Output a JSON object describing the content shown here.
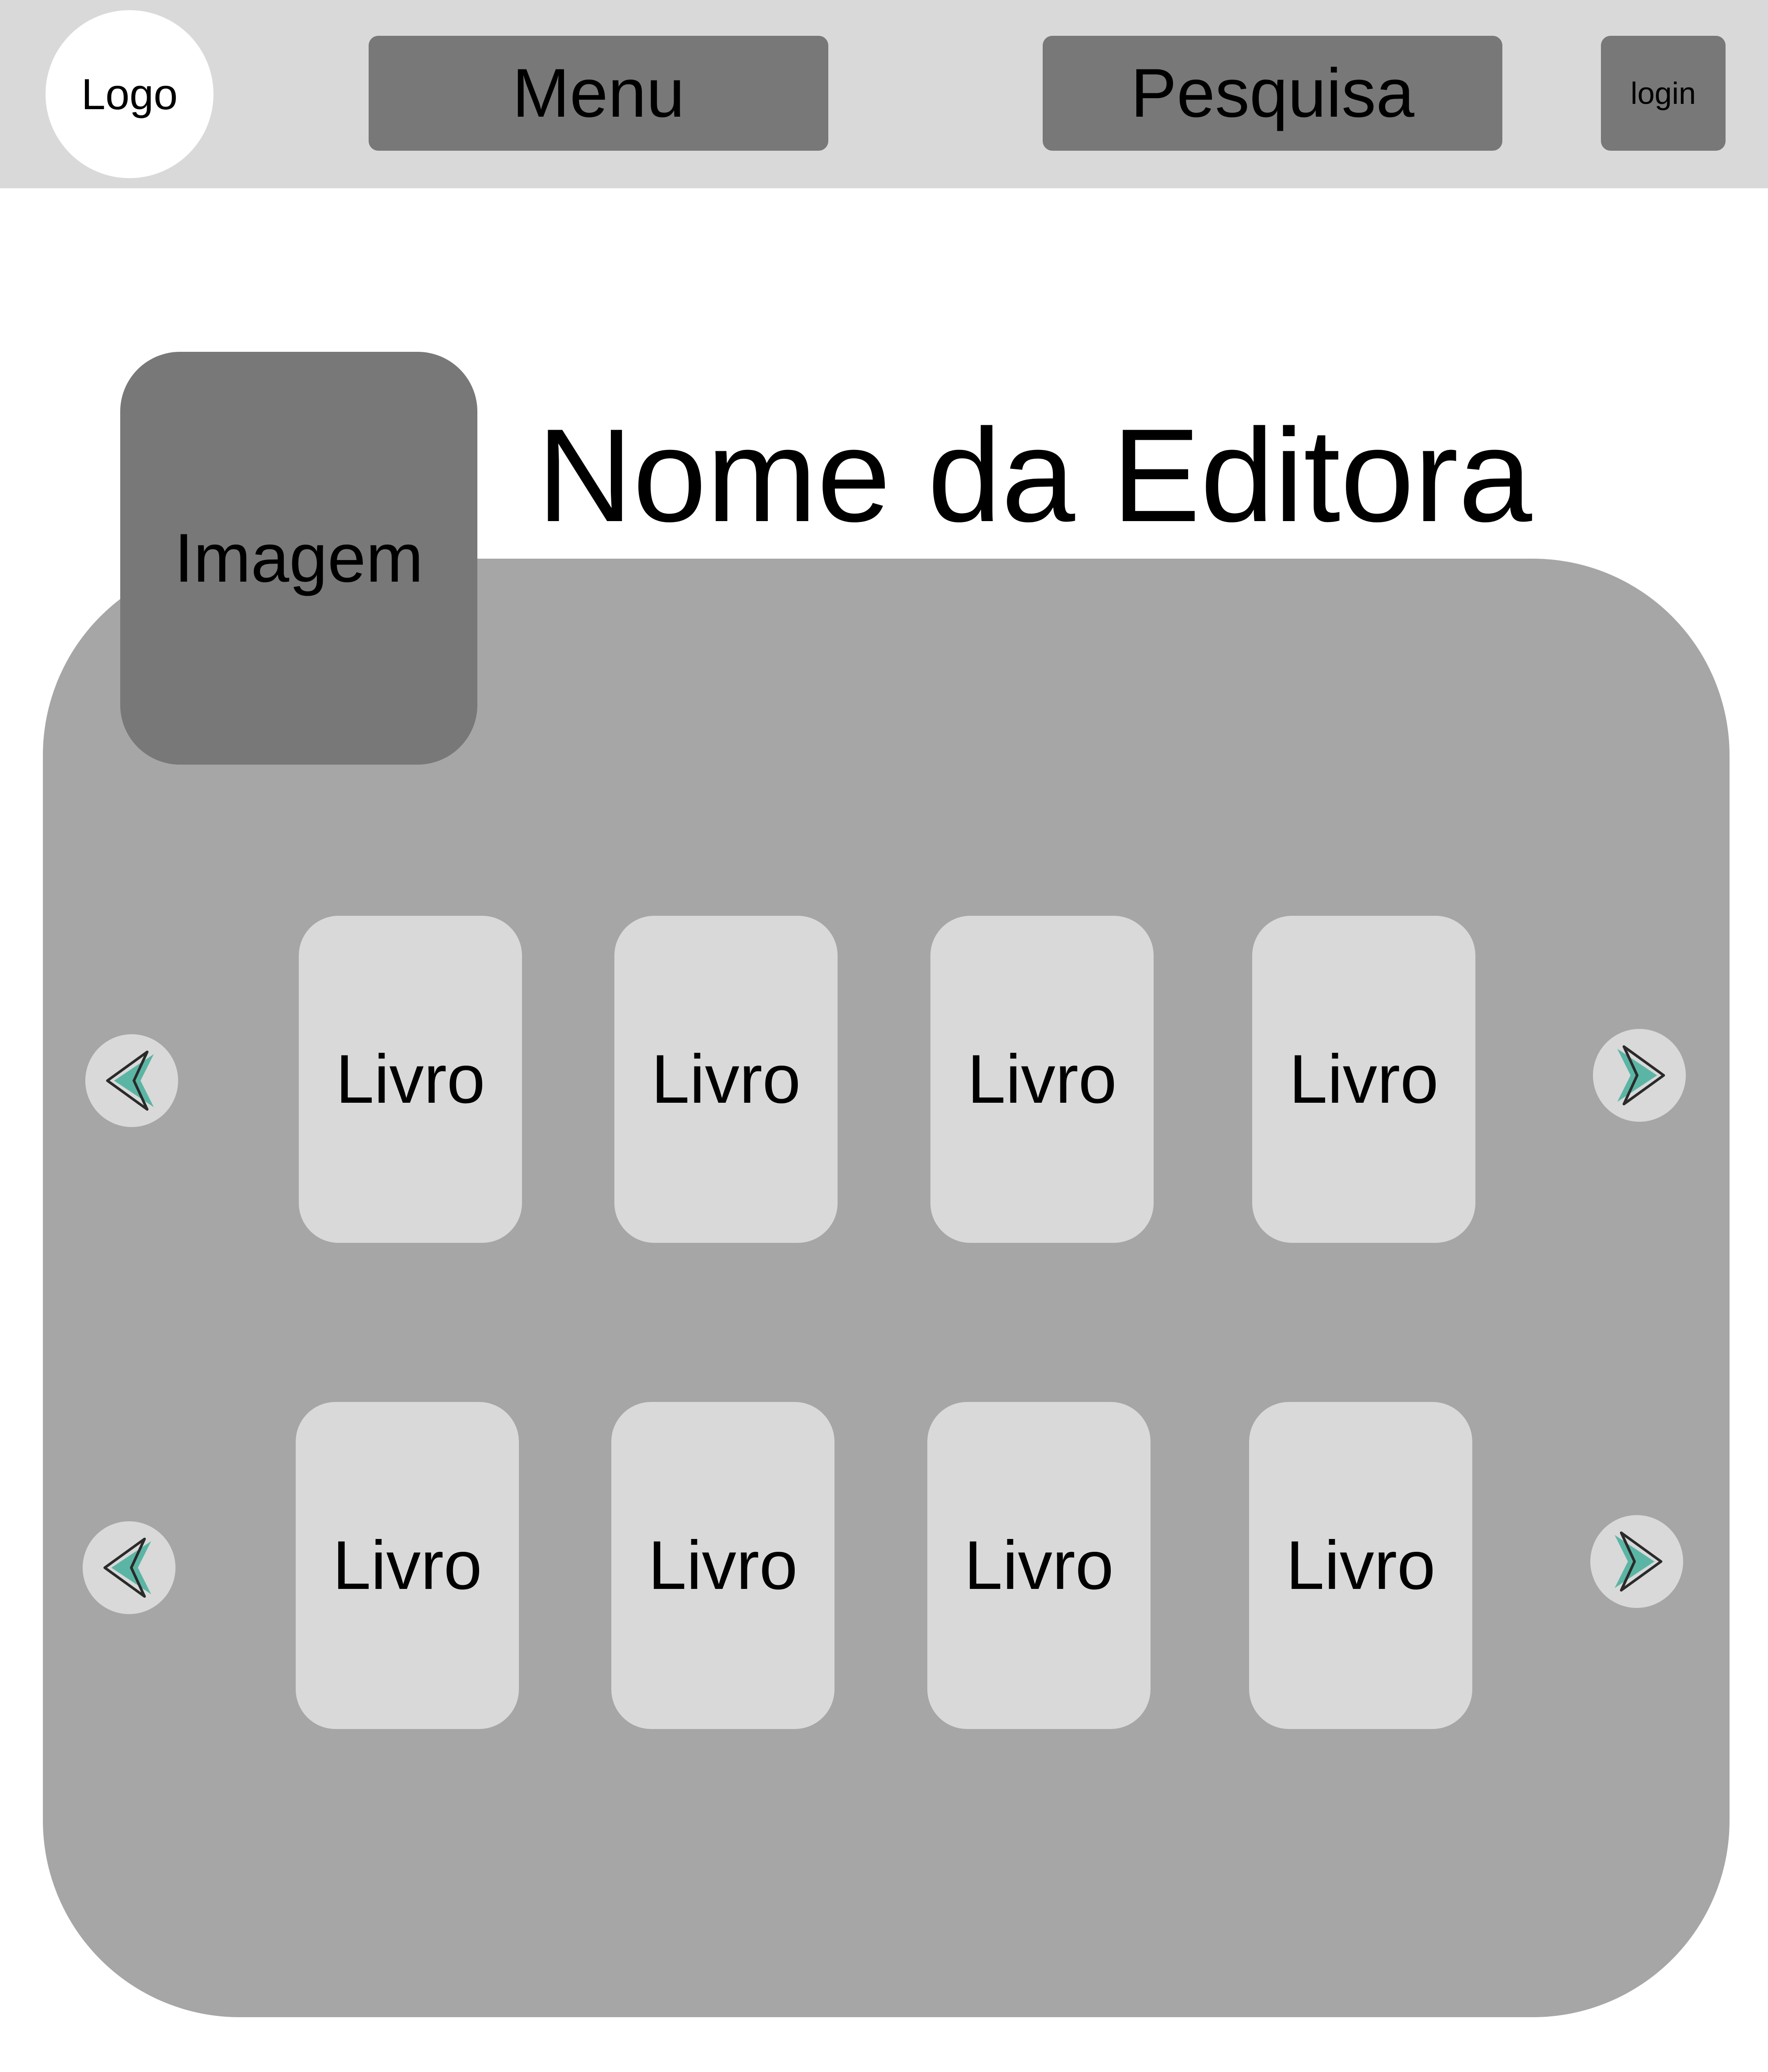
{
  "header": {
    "logo_label": "Logo",
    "menu_label": "Menu",
    "search_label": "Pesquisa",
    "login_label": "login"
  },
  "publisher": {
    "image_label": "Imagem",
    "name": "Nome da Editora"
  },
  "carousels": [
    {
      "books": [
        "Livro",
        "Livro",
        "Livro",
        "Livro"
      ]
    },
    {
      "books": [
        "Livro",
        "Livro",
        "Livro",
        "Livro"
      ]
    }
  ],
  "icons": {
    "prev": "chevron-left-icon",
    "next": "chevron-right-icon"
  },
  "colors": {
    "topbar": "#d9d9d9",
    "button": "#787878",
    "panel": "#a6a6a6",
    "card": "#d9d9d9",
    "arrow_accent": "#5bb5a4"
  }
}
